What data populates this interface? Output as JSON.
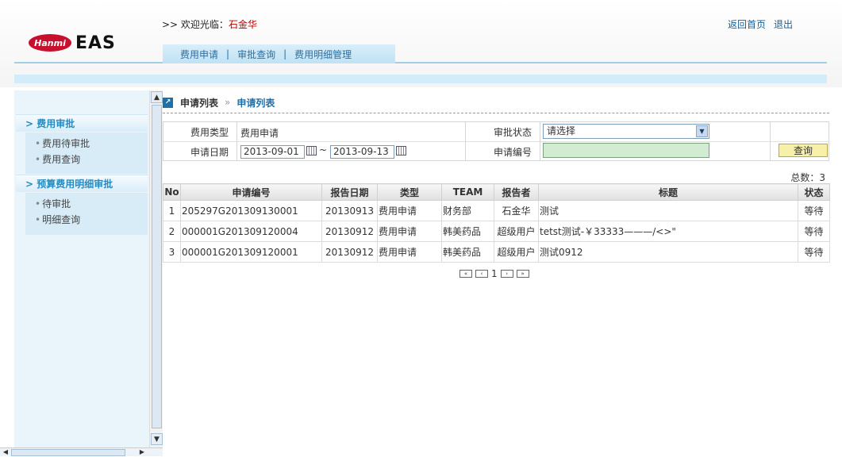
{
  "header": {
    "logo_mark": "Hanmi",
    "logo_text": "EAS",
    "welcome_prefix": ">> 欢迎光临：",
    "welcome_user": "石金华",
    "links": [
      "返回首页",
      "退出"
    ],
    "tabs": [
      "费用申请",
      "审批查询",
      "费用明细管理"
    ],
    "tab_separator": "|"
  },
  "sidebar": {
    "groups": [
      {
        "title": "> 费用审批",
        "items": [
          "费用待审批",
          "费用查询"
        ]
      },
      {
        "title": "> 预算费用明细审批",
        "items": [
          "待审批",
          "明细查询"
        ]
      }
    ],
    "item_bullet": "•"
  },
  "breadcrumb": {
    "level1": "申请列表",
    "separator": "»",
    "level2": "申请列表"
  },
  "filters": {
    "type_label": "费用类型",
    "type_value": "费用申请",
    "status_label": "审批状态",
    "status_value": "请选择",
    "date_label": "申请日期",
    "date_from": "2013-09-01",
    "date_separator": "~",
    "date_to": "2013-09-13",
    "code_label": "申请编号",
    "code_value": "",
    "query_button": "查询"
  },
  "total": "总数：3",
  "table": {
    "columns": [
      "No",
      "申请编号",
      "报告日期",
      "类型",
      "TEAM",
      "报告者",
      "标题",
      "状态"
    ],
    "rows": [
      [
        "1",
        "205297G201309130001",
        "20130913",
        "费用申请",
        "财务部",
        "石金华",
        "测试",
        "等待"
      ],
      [
        "2",
        "000001G201309120004",
        "20130912",
        "费用申请",
        "韩美药品",
        "超级用户",
        "tetst测试-￥33333———/<>\"",
        "等待"
      ],
      [
        "3",
        "000001G201309120001",
        "20130912",
        "费用申请",
        "韩美药品",
        "超级用户",
        "测试0912",
        "等待"
      ]
    ]
  },
  "pager": {
    "first": "«",
    "prev": "‹",
    "current_page": "1",
    "next": "›",
    "last": "»"
  },
  "colors": {
    "accent": "#1f6fa8",
    "sidebar_bg": "#e9f4fb",
    "user": "#c00000",
    "query_button": "#f7f0a8"
  }
}
